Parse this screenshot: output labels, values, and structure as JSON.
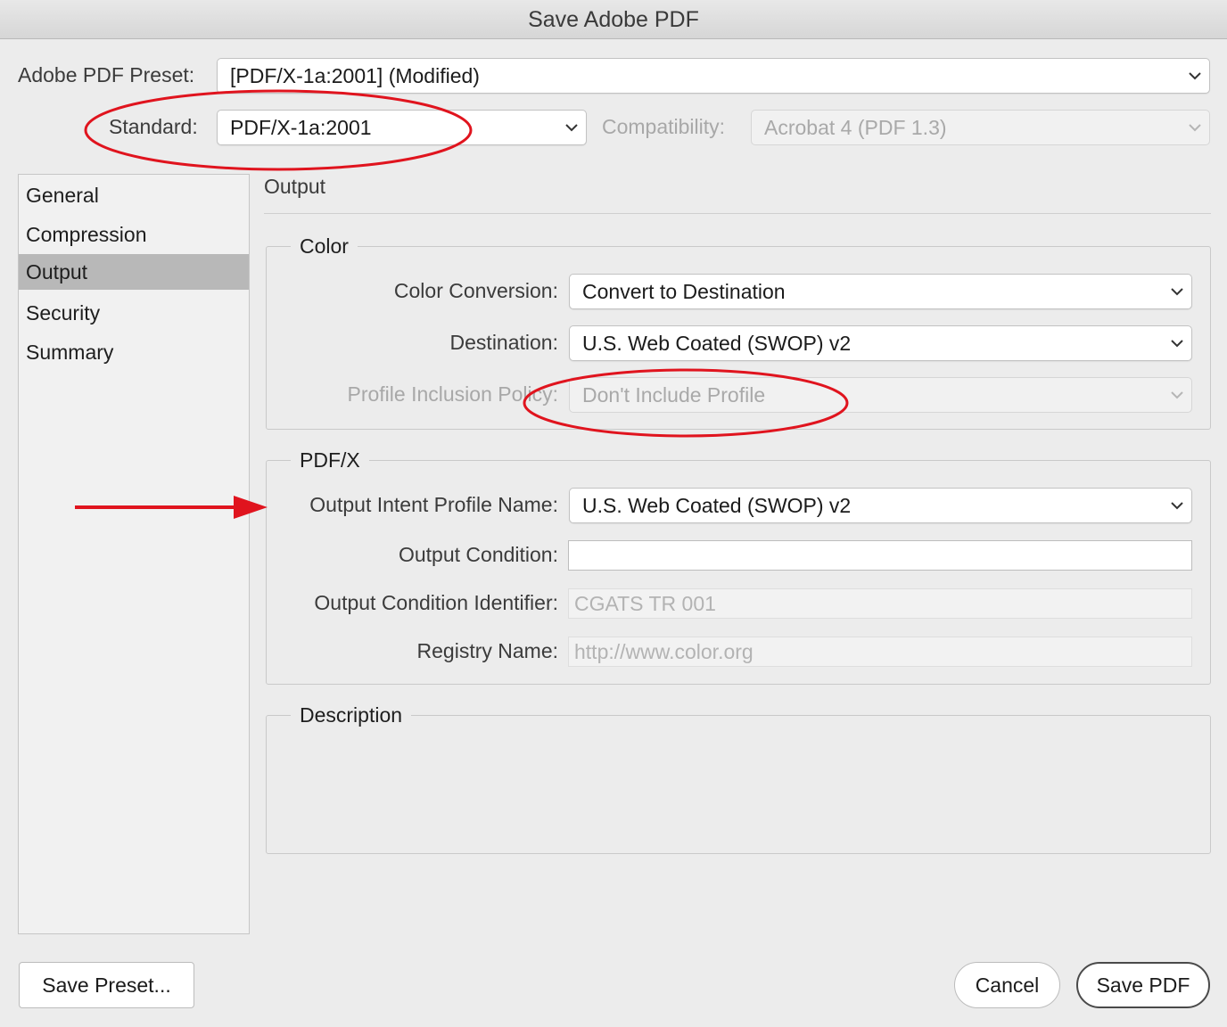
{
  "window": {
    "title": "Save Adobe PDF"
  },
  "preset": {
    "label": "Adobe PDF Preset:",
    "value": "[PDF/X-1a:2001] (Modified)"
  },
  "standard": {
    "label": "Standard:",
    "value": "PDF/X-1a:2001"
  },
  "compatibility": {
    "label": "Compatibility:",
    "value": "Acrobat 4 (PDF 1.3)"
  },
  "sidebar": {
    "items": [
      {
        "label": "General"
      },
      {
        "label": "Compression"
      },
      {
        "label": "Output"
      },
      {
        "label": "Security"
      },
      {
        "label": "Summary"
      }
    ],
    "selected": "Output"
  },
  "panel": {
    "title": "Output",
    "color_group": {
      "title": "Color",
      "color_conversion": {
        "label": "Color Conversion:",
        "value": "Convert to Destination"
      },
      "destination": {
        "label": "Destination:",
        "value": "U.S. Web Coated (SWOP) v2"
      },
      "profile_inclusion": {
        "label": "Profile Inclusion Policy:",
        "value": "Don't Include Profile"
      }
    },
    "pdfx_group": {
      "title": "PDF/X",
      "output_intent": {
        "label": "Output Intent Profile Name:",
        "value": "U.S. Web Coated (SWOP) v2"
      },
      "output_condition": {
        "label": "Output Condition:",
        "value": ""
      },
      "output_condition_identifier": {
        "label": "Output Condition Identifier:",
        "value": "CGATS TR 001"
      },
      "registry_name": {
        "label": "Registry Name:",
        "value": "http://www.color.org"
      }
    },
    "description_group": {
      "title": "Description",
      "text": ""
    }
  },
  "buttons": {
    "save_preset": "Save Preset...",
    "cancel": "Cancel",
    "save_pdf": "Save PDF"
  },
  "annotations": {
    "color": "#e0141e"
  }
}
